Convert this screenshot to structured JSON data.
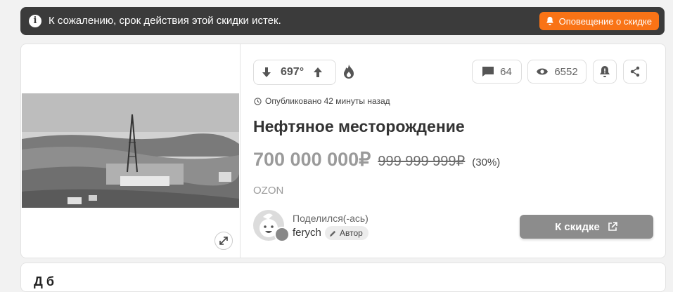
{
  "banner": {
    "message": "К сожалению, срок действия этой скидки истек.",
    "alert_button": "Оповещение о скидке",
    "bg_color": "#3b3b3b",
    "accent_color": "#f97316"
  },
  "deal": {
    "votes": "697°",
    "comments": "64",
    "views": "6552",
    "published": "Опубликовано 42 минуты назад",
    "title": "Нефтяное месторождение",
    "price": "700 000 000₽",
    "old_price": "999 999 999₽",
    "discount": "(30%)",
    "merchant": "OZON",
    "shared_by_label": "Поделился(-ась)",
    "username": "ferych",
    "author_badge": "Автор",
    "cta_label": "К скидке"
  },
  "icons": [
    "info-icon",
    "bell-icon",
    "arrow-down-icon",
    "arrow-up-icon",
    "fire-icon",
    "comment-icon",
    "eye-icon",
    "bell-alert-icon",
    "share-icon",
    "clock-icon",
    "expand-icon",
    "pencil-icon",
    "external-link-icon"
  ],
  "next_card": {
    "partial_text": "Д         б"
  }
}
